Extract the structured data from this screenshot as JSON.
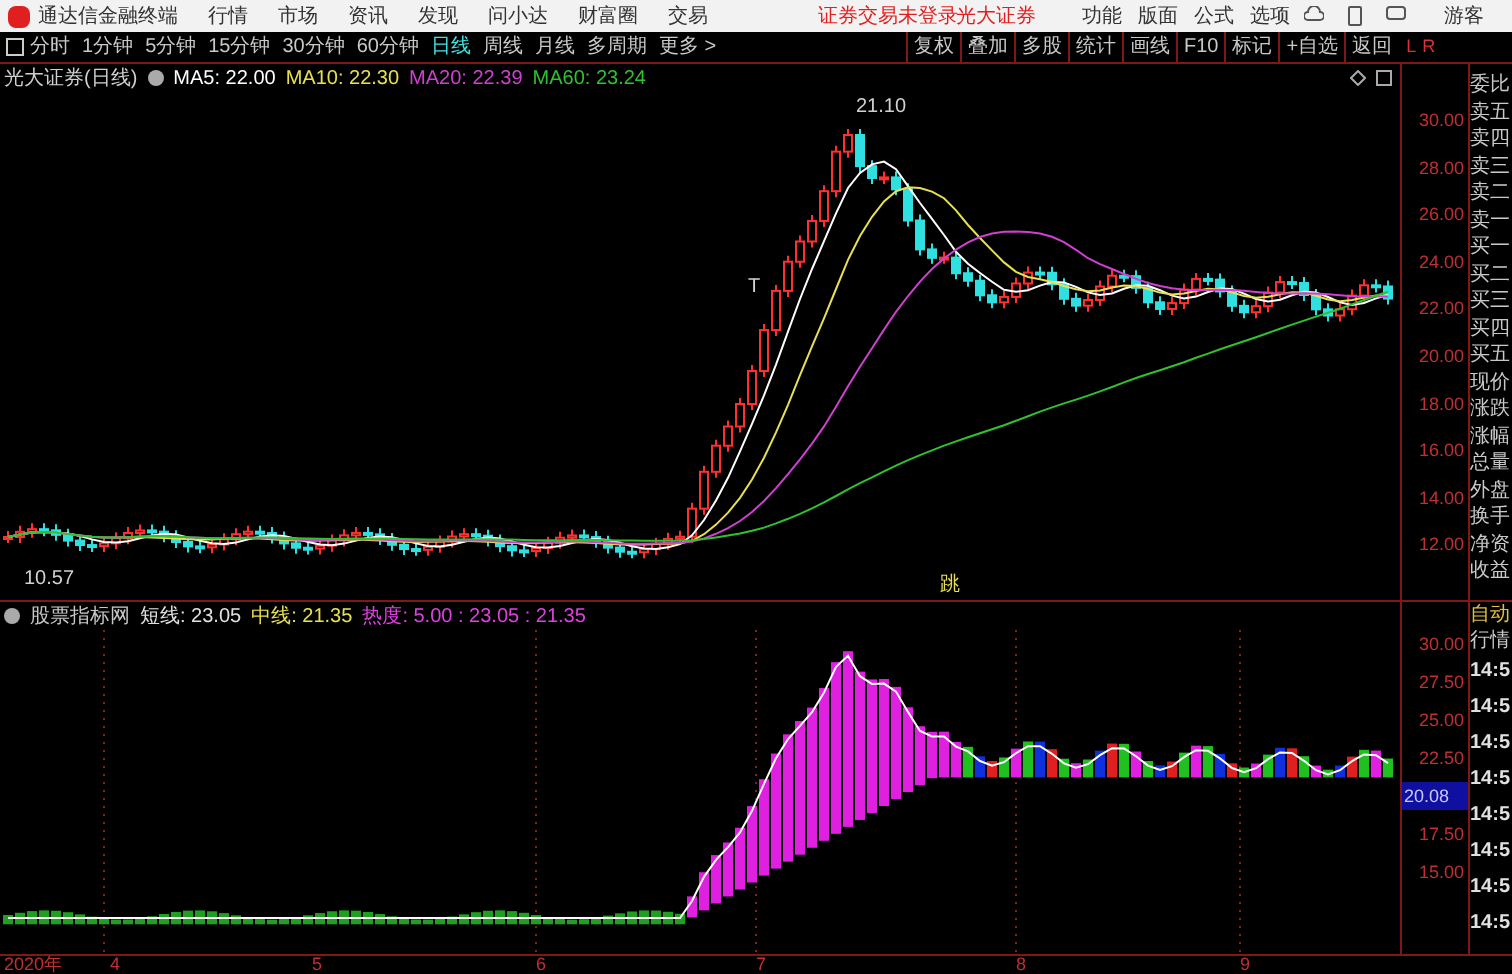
{
  "menu_bar": {
    "app_title": "通达信金融终端",
    "menus": [
      "行情",
      "市场",
      "资讯",
      "发现",
      "问小达",
      "财富圈",
      "交易"
    ],
    "login_status": "证券交易未登录",
    "broker": "光大证券",
    "right_menus": [
      "功能",
      "版面",
      "公式",
      "选项"
    ],
    "user": "游客"
  },
  "period_tabs": [
    {
      "label": "分时",
      "selected": false
    },
    {
      "label": "1分钟",
      "selected": false
    },
    {
      "label": "5分钟",
      "selected": false
    },
    {
      "label": "15分钟",
      "selected": false
    },
    {
      "label": "30分钟",
      "selected": false
    },
    {
      "label": "60分钟",
      "selected": false
    },
    {
      "label": "日线",
      "selected": true
    },
    {
      "label": "周线",
      "selected": false
    },
    {
      "label": "月线",
      "selected": false
    },
    {
      "label": "多周期",
      "selected": false
    },
    {
      "label": "更多 >",
      "selected": false
    }
  ],
  "tools": [
    "复权",
    "叠加",
    "多股",
    "统计",
    "画线",
    "F10",
    "标记",
    "+自选",
    "返回"
  ],
  "panel_header": [
    "L",
    "R"
  ],
  "main_chart": {
    "title": "光大证券(日线)",
    "ma": [
      {
        "label": "MA5: 22.00",
        "color": "#ffffff"
      },
      {
        "label": "MA10: 22.30",
        "color": "#e8e050"
      },
      {
        "label": "MA20: 22.39",
        "color": "#d040d0"
      },
      {
        "label": "MA60: 23.24",
        "color": "#30c030"
      }
    ],
    "annotations": [
      "21.10",
      "10.57",
      "T",
      "跳"
    ],
    "price_axis": [
      "30.00",
      "28.00",
      "26.00",
      "24.00",
      "22.00",
      "20.00",
      "18.00",
      "16.00",
      "14.00",
      "12.00"
    ]
  },
  "quote_panel": {
    "labels": [
      "委比",
      "卖五",
      "卖四",
      "卖三",
      "卖二",
      "卖一",
      "买一",
      "买二",
      "买三",
      "买四",
      "买五",
      "现价",
      "涨跌",
      "涨幅",
      "总量",
      "外盘",
      "换手",
      "净资",
      "收益"
    ]
  },
  "indicator": {
    "name": "股票指标网",
    "lines": [
      {
        "label": "短线: 23.05",
        "color": "#e0e0e0"
      },
      {
        "label": "中线: 21.35",
        "color": "#e8e050"
      },
      {
        "label": "热度: 5.00 : 23.05 : 21.35",
        "color": "#e040e0"
      }
    ],
    "axis": [
      {
        "label": "30.00",
        "kind": "tick"
      },
      {
        "label": "27.50",
        "kind": "tick"
      },
      {
        "label": "25.00",
        "kind": "tick"
      },
      {
        "label": "22.50",
        "kind": "tick"
      },
      {
        "label": "20.08",
        "kind": "current"
      },
      {
        "label": "17.50",
        "kind": "tick"
      },
      {
        "label": "15.00",
        "kind": "tick"
      }
    ],
    "panel_labels": [
      "自动",
      "行情"
    ],
    "times": [
      "14:5",
      "14:5",
      "14:5",
      "14:5",
      "14:5",
      "14:5",
      "14:5",
      "14:5"
    ]
  },
  "date_axis": [
    "2020年",
    "4",
    "5",
    "6",
    "7",
    "8",
    "9"
  ]
}
